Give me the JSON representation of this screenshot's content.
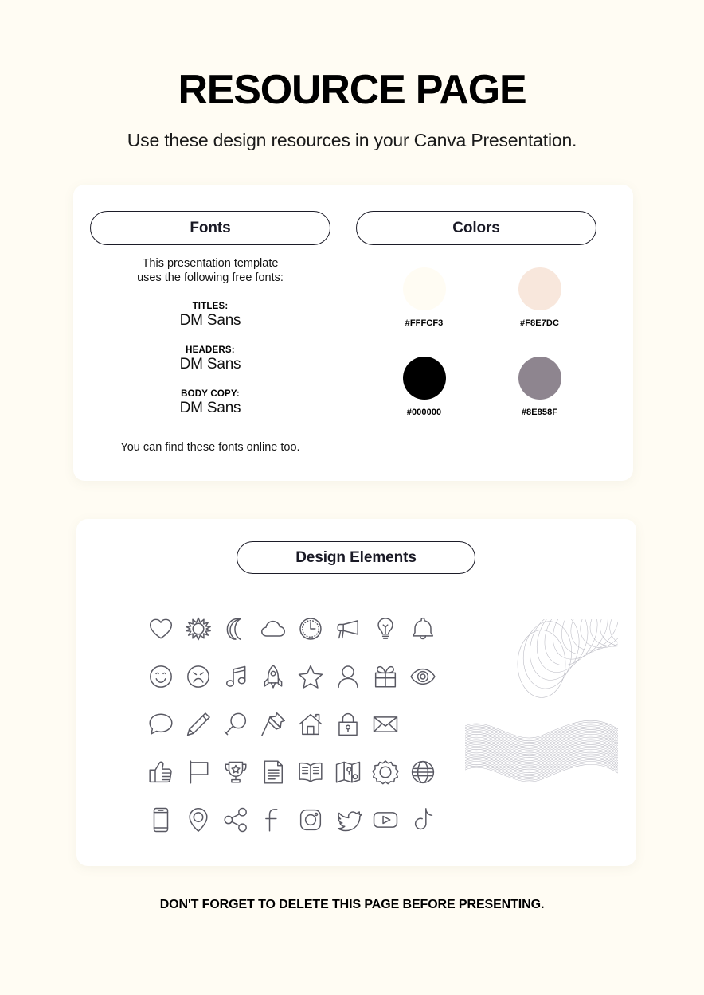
{
  "header": {
    "title": "RESOURCE PAGE",
    "subtitle": "Use these design resources in your Canva Presentation."
  },
  "fonts_section": {
    "heading": "Fonts",
    "intro_line1": "This presentation template",
    "intro_line2": "uses the following free fonts:",
    "entries": [
      {
        "role": "TITLES:",
        "name": "DM Sans"
      },
      {
        "role": "HEADERS:",
        "name": "DM Sans"
      },
      {
        "role": "BODY COPY:",
        "name": "DM Sans"
      }
    ],
    "footer": "You can find these fonts online too."
  },
  "colors_section": {
    "heading": "Colors",
    "swatches": [
      {
        "label": "#FFFCF3",
        "hex": "#FFFCF3"
      },
      {
        "label": "#F8E7DC",
        "hex": "#F8E7DC"
      },
      {
        "label": "#000000",
        "hex": "#000000"
      },
      {
        "label": "#8E858F",
        "hex": "#8E858F"
      }
    ]
  },
  "design_section": {
    "heading": "Design Elements",
    "icons": [
      "heart-icon",
      "sun-icon",
      "moon-icon",
      "cloud-icon",
      "clock-icon",
      "megaphone-icon",
      "lightbulb-icon",
      "bell-icon",
      "smiley-face-icon",
      "sad-face-icon",
      "music-note-icon",
      "rocket-icon",
      "star-icon",
      "person-icon",
      "gift-icon",
      "eye-icon",
      "chat-bubble-icon",
      "pencil-icon",
      "magnifier-icon",
      "pushpin-icon",
      "home-icon",
      "lock-icon",
      "envelope-icon",
      "thumbs-up-icon",
      "flag-icon",
      "trophy-icon",
      "document-icon",
      "open-book-icon",
      "map-icon",
      "gear-icon",
      "globe-icon",
      "smartphone-icon",
      "map-pin-icon",
      "share-icon",
      "facebook-icon",
      "instagram-icon",
      "twitter-icon",
      "youtube-icon",
      "tiktok-icon"
    ],
    "decorations": [
      "spirograph-circles-graphic",
      "wavy-lines-graphic"
    ]
  },
  "footer": {
    "note": "DON'T FORGET TO DELETE THIS PAGE BEFORE PRESENTING."
  }
}
